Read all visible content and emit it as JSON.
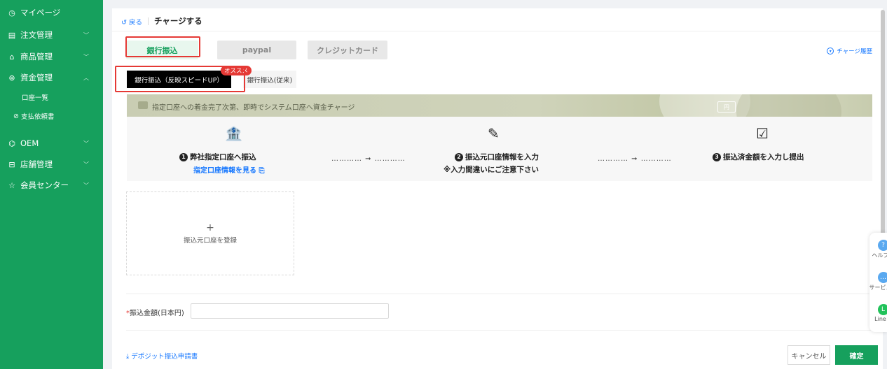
{
  "sidebar": {
    "items": [
      {
        "label": "マイページ",
        "icon": "clock-icon",
        "glyph": "◷"
      },
      {
        "label": "注文管理",
        "icon": "list-icon",
        "glyph": "▤",
        "chevron": "﹀"
      },
      {
        "label": "商品管理",
        "icon": "bag-icon",
        "glyph": "⌂",
        "chevron": "﹀"
      },
      {
        "label": "資金管理",
        "icon": "money-icon",
        "glyph": "⊛",
        "chevron": "︿"
      },
      {
        "label": "OEM",
        "icon": "oem-icon",
        "glyph": "⌬",
        "chevron": "﹀"
      },
      {
        "label": "店舗管理",
        "icon": "store-icon",
        "glyph": "⊟",
        "chevron": "﹀"
      },
      {
        "label": "会員センター",
        "icon": "star-icon",
        "glyph": "☆",
        "chevron": "﹀"
      }
    ],
    "subitems": [
      {
        "label": "口座一覧"
      },
      {
        "label": "支払依頼書",
        "glyph": "⊘"
      }
    ]
  },
  "header": {
    "back_label": "戻る",
    "back_glyph": "↺",
    "title": "チャージする"
  },
  "tabs": {
    "bank": "銀行振込",
    "paypal": "paypal",
    "credit": "クレジットカード"
  },
  "history": {
    "label": "チャージ履歴",
    "glyph": "▾"
  },
  "subtabs": {
    "fast": "銀行振込（反映スピードUP）",
    "legacy": "銀行振込(従来)",
    "badge": "オススメ"
  },
  "banner": {
    "text": "指定口座への着金完了次第、即時でシステム口座へ資金チャージ",
    "card_glyph": "円"
  },
  "steps": {
    "step1": {
      "num": "1",
      "text": "弊社指定口座へ振込",
      "link": "指定口座情報を見る",
      "link_glyph": "⎘",
      "icon_glyph": "🏦"
    },
    "step2": {
      "num": "2",
      "text": "振込元口座情報を入力",
      "note": "※入力間違いにご注意下さい",
      "icon_glyph": "✎"
    },
    "step3": {
      "num": "3",
      "text": "振込済金額を入力し提出",
      "icon_glyph": "☑"
    },
    "connector": "………… ➞ …………"
  },
  "add_account": {
    "plus": "+",
    "label": "振込元口座を登録"
  },
  "amount": {
    "required_mark": "*",
    "label": "振込金額(日本円)",
    "value": "",
    "placeholder": ""
  },
  "footer": {
    "deposit_label": "デポジット振込申請書",
    "deposit_glyph": "⤓",
    "cancel": "キャンセル",
    "confirm": "確定"
  },
  "float_panel": {
    "items": [
      {
        "label": "ヘルプ",
        "glyph": "?",
        "color": "#5aa9f0"
      },
      {
        "label": "サービス",
        "glyph": "…",
        "color": "#5aa9f0"
      },
      {
        "label": "Line",
        "glyph": "L",
        "color": "#22c35b"
      }
    ]
  },
  "colors": {
    "brand": "#16a05d",
    "link": "#1677ff",
    "highlight": "#e53935"
  }
}
